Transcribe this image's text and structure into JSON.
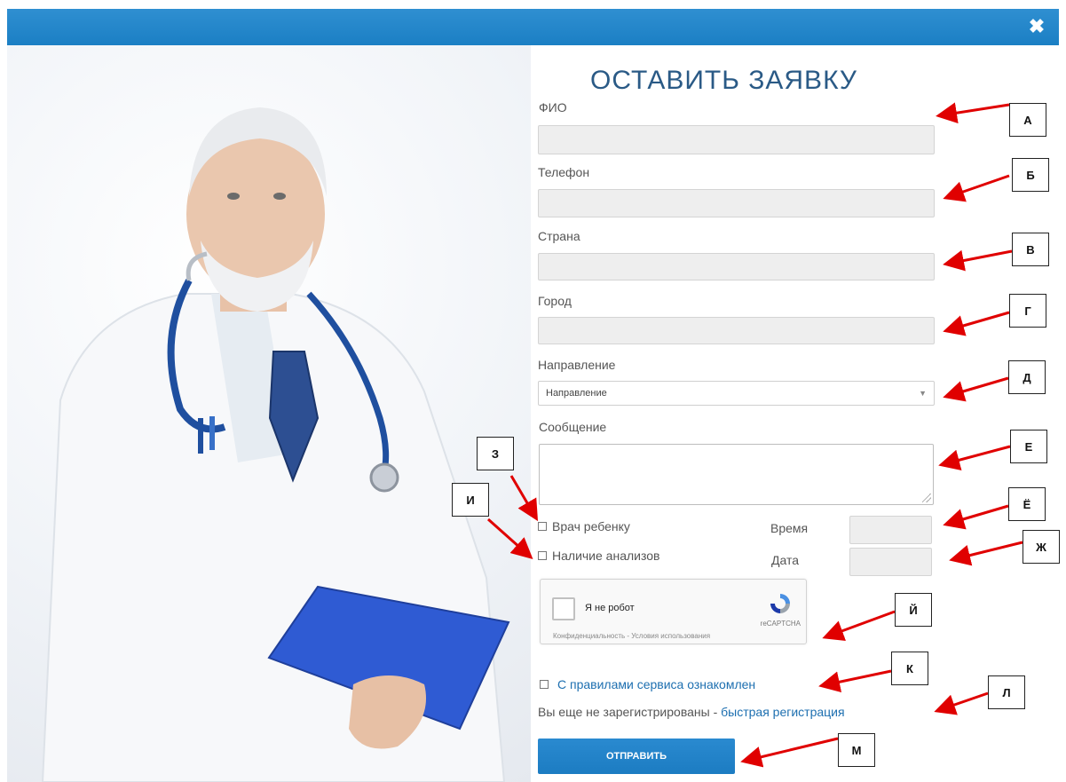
{
  "modal": {
    "title": "ОСТАВИТЬ ЗАЯВКУ",
    "close_icon": "✖"
  },
  "form": {
    "fio_label": "ФИО",
    "phone_label": "Телефон",
    "country_label": "Страна",
    "city_label": "Город",
    "direction_label": "Направление",
    "direction_selected": "Направление",
    "message_label": "Сообщение",
    "child_doctor_label": "Врач ребенку",
    "tests_label": "Наличие анализов",
    "time_label": "Время",
    "date_label": "Дата",
    "captcha_text": "Я не робот",
    "captcha_brand": "reCAPTCHA",
    "captcha_footer": "Конфиденциальность - Условия использования",
    "rules_label": "С правилами сервиса ознакомлен",
    "not_registered": "Вы еще не зарегистрированы - ",
    "quick_register": "быстрая регистрация",
    "submit_label": "ОТПРАВИТЬ"
  },
  "markers": [
    "А",
    "Б",
    "В",
    "Г",
    "Д",
    "Е",
    "З",
    "И",
    "Ё",
    "Ж",
    "Й",
    "К",
    "Л",
    "М"
  ],
  "colors": {
    "accent": "#1b7fc4",
    "title": "#2a5a86",
    "arrow": "#e00000"
  }
}
